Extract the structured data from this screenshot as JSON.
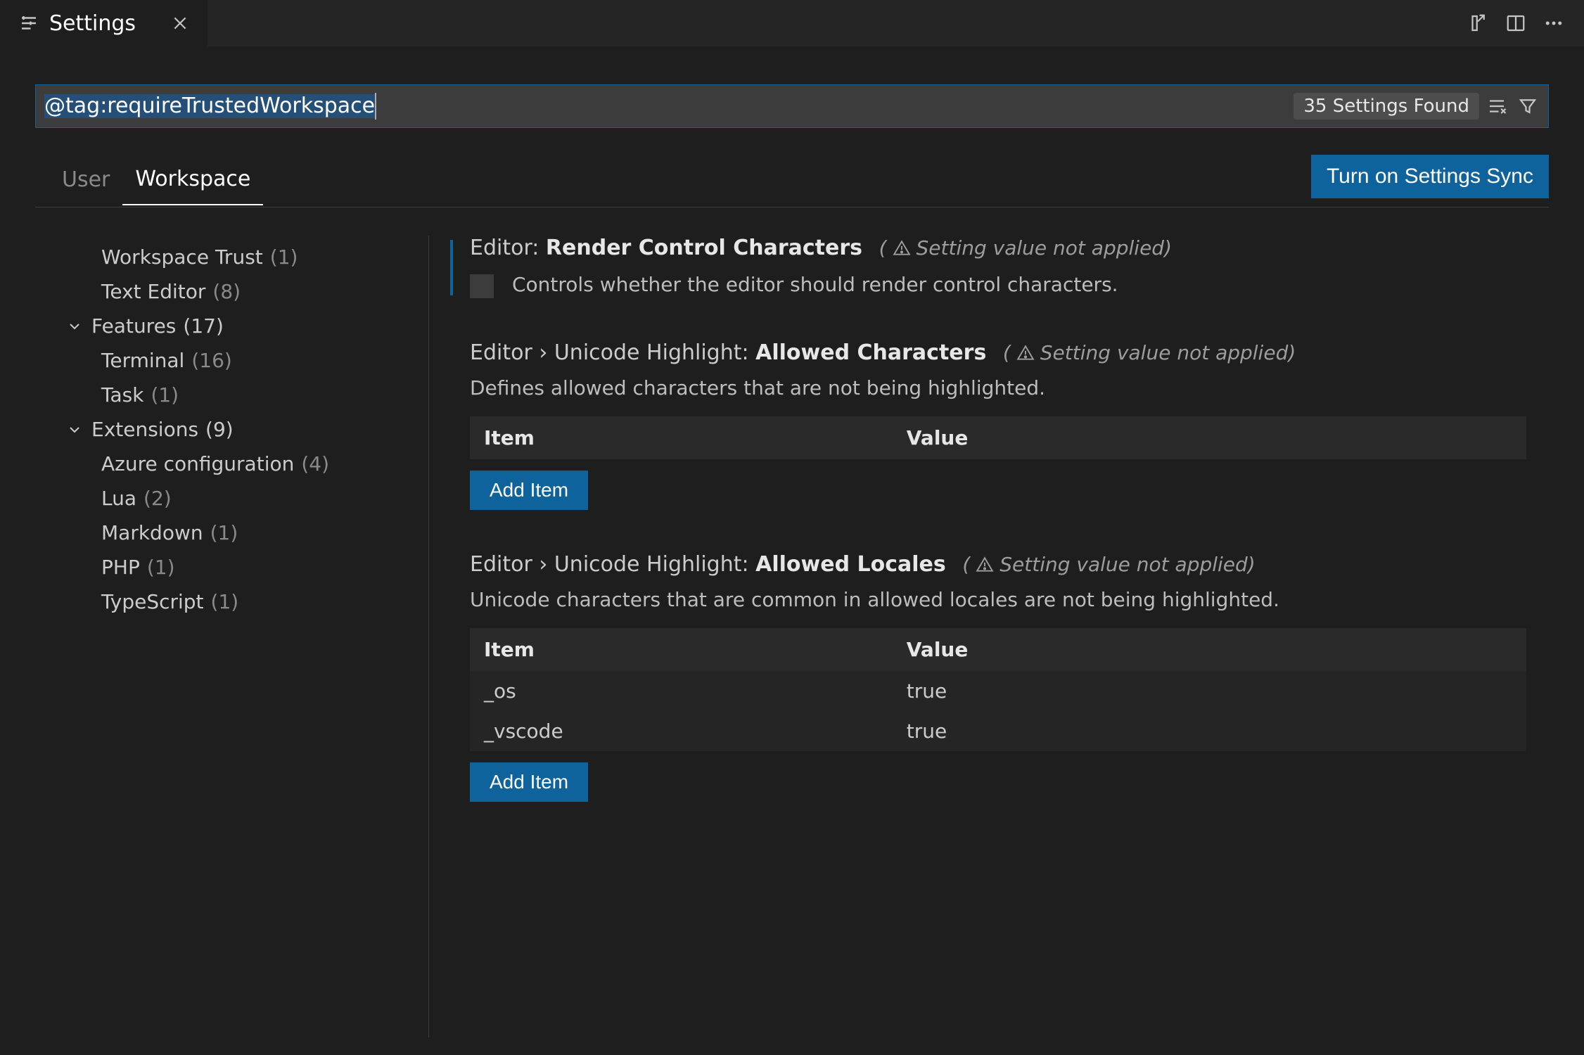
{
  "tab": {
    "title": "Settings"
  },
  "search": {
    "value": "@tag:requireTrustedWorkspace",
    "count_label": "35 Settings Found"
  },
  "scopes": {
    "user": "User",
    "workspace": "Workspace"
  },
  "sync_button": "Turn on Settings Sync",
  "toc": {
    "workspace_trust": {
      "label": "Workspace Trust",
      "count": "(1)"
    },
    "text_editor": {
      "label": "Text Editor",
      "count": "(8)"
    },
    "features": {
      "label": "Features",
      "count": "(17)"
    },
    "terminal": {
      "label": "Terminal",
      "count": "(16)"
    },
    "task": {
      "label": "Task",
      "count": "(1)"
    },
    "extensions": {
      "label": "Extensions",
      "count": "(9)"
    },
    "azure": {
      "label": "Azure configuration",
      "count": "(4)"
    },
    "lua": {
      "label": "Lua",
      "count": "(2)"
    },
    "markdown": {
      "label": "Markdown",
      "count": "(1)"
    },
    "php": {
      "label": "PHP",
      "count": "(1)"
    },
    "typescript": {
      "label": "TypeScript",
      "count": "(1)"
    }
  },
  "not_applied": "Setting value not applied)",
  "settings": {
    "render_control": {
      "group": "Editor:",
      "name": "Render Control Characters",
      "desc": "Controls whether the editor should render control characters."
    },
    "allowed_chars": {
      "group": "Editor › Unicode Highlight:",
      "name": "Allowed Characters",
      "desc": "Defines allowed characters that are not being highlighted.",
      "col_item": "Item",
      "col_value": "Value"
    },
    "allowed_locales": {
      "group": "Editor › Unicode Highlight:",
      "name": "Allowed Locales",
      "desc": "Unicode characters that are common in allowed locales are not being highlighted.",
      "col_item": "Item",
      "col_value": "Value",
      "rows": [
        {
          "item": "_os",
          "value": "true"
        },
        {
          "item": "_vscode",
          "value": "true"
        }
      ]
    }
  },
  "add_item": "Add Item",
  "paren_open": "("
}
